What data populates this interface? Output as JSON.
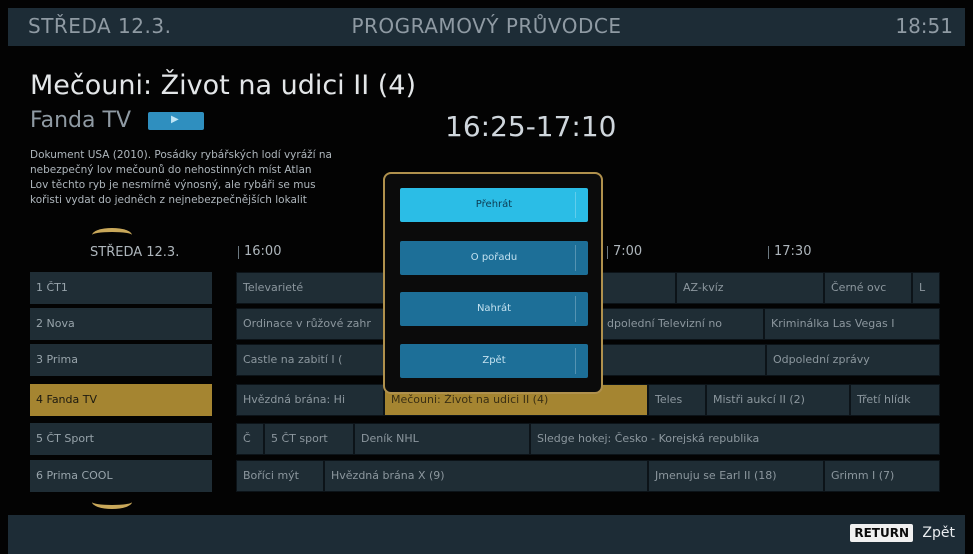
{
  "header": {
    "date": "STŘEDA 12.3.",
    "title": "PROGRAMOVÝ PRŮVODCE",
    "clock": "18:51"
  },
  "program": {
    "title": "Mečouni: Život na udici II (4)",
    "channel": "Fanda TV",
    "badge_icon": "play-icon",
    "time_range": "16:25-17:10",
    "description_lines": [
      "Dokument USA (2010). Posádky rybářských lodí vyráží na",
      "nebezpečný lov mečounů do nehostinných míst Atlan",
      "Lov těchto ryb je nesmírně výnosný, ale rybáři se mus",
      "kořisti vydat do jedněch z nejnebezpečnějších lokalit"
    ]
  },
  "timeline": {
    "day": "STŘEDA 12.3.",
    "times": [
      "16:00",
      "7:00",
      "17:30"
    ]
  },
  "channels": [
    "1 ČT1",
    "2 Nova",
    "3 Prima",
    "4 Fanda TV",
    "5 ČT Sport",
    "6 Prima COOL"
  ],
  "epg": {
    "row1": [
      "Televarieté",
      "AZ-kvíz",
      "Černé ovc",
      "L"
    ],
    "row2": [
      "Ordinace v růžové zahr",
      "dpolední Televizní no",
      "Kriminálka Las Vegas I"
    ],
    "row3": [
      "Castle na zabití I (",
      "Odpolední zprávy"
    ],
    "row4": [
      "Hvězdná brána: Hi",
      "Mečouni: Život na udici II (4)",
      "Teles",
      "Mistři aukcí II (2)",
      "Třetí hlídk"
    ],
    "row5": [
      "Č",
      "5 ČT sport",
      "Deník NHL",
      "Sledge hokej: Česko - Korejská republika"
    ],
    "row6": [
      "Boříci mýt",
      "Hvězdná brána X (9)",
      "Jmenuju se Earl II (18)",
      "Grimm I (7)"
    ]
  },
  "dialog": {
    "buttons": [
      "Přehrát",
      "O pořadu",
      "Nahrát",
      "Zpět"
    ]
  },
  "footer": {
    "return_key": "RETURN",
    "return_label": "Zpět"
  },
  "colors": {
    "accent_gold": "#a58531",
    "dialog_primary": "#2bbde6",
    "dialog_secondary": "#1d6f98",
    "header_bg": "#1d2c36"
  }
}
